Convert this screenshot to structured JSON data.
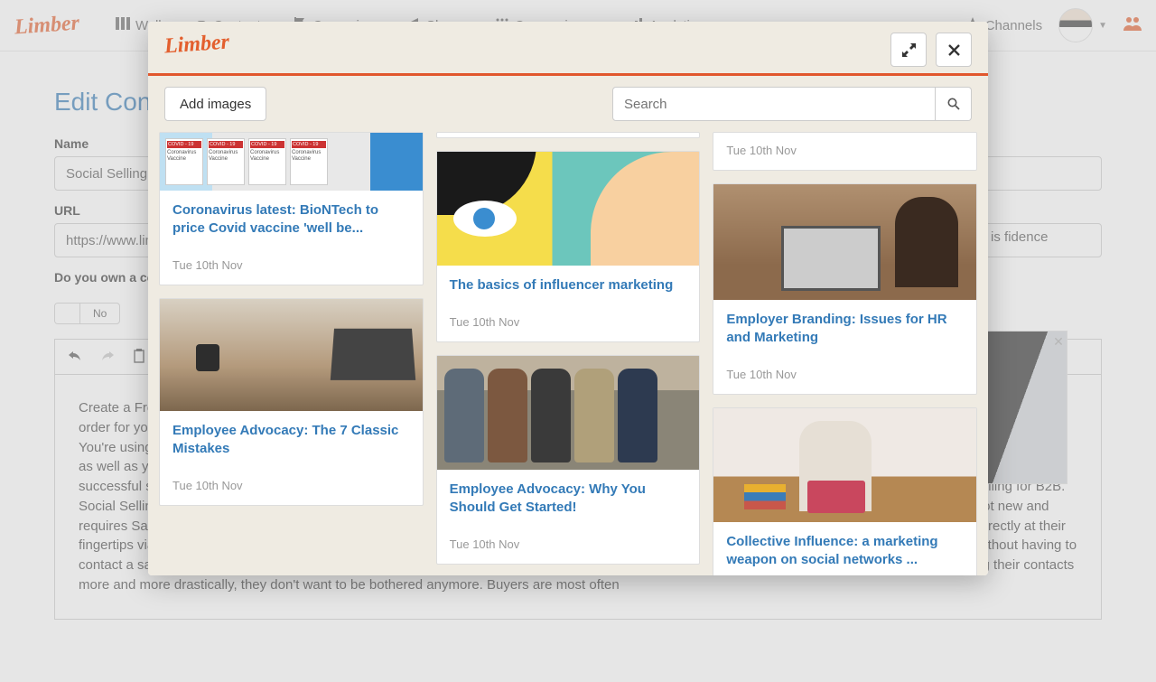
{
  "logo_text": "Limber",
  "nav": {
    "items": [
      {
        "label": "Walls",
        "dropdown": false
      },
      {
        "label": "Contents",
        "dropdown": false
      },
      {
        "label": "Campaigns",
        "dropdown": false
      },
      {
        "label": "Shares",
        "dropdown": false
      },
      {
        "label": "Conversions",
        "dropdown": true
      },
      {
        "label": "Analytics",
        "dropdown": true
      }
    ],
    "channels_label": "Channels"
  },
  "page": {
    "title": "Edit Content",
    "name_label": "Name",
    "name_value": "Social Selling: Be",
    "url_label": "URL",
    "url_value": "https://www.limbe",
    "own_label": "Do you own a copy",
    "toggle_value": "No",
    "right_snippet": "d social seller is fidence before",
    "body_text": "Create a Free Account to Discover all the features of LimberGet Started – Free Enterprise accounts allows you all the features of Limber. We offer a free account in order for you to discover Limber and how it fits your projects. Fill out the form and get started with your team. Max SwansonLeave a Comment You're doing it, right? You're using social media to grow your audience to inform them about your work and draw them into your sales funnel. Of course you are. However, it's not working, as well as you'd hoped or would like. Maybe you see others that seem to have it all figured out. Being on social media won't make you a good social seller. A successful social seller is someone who creates a personal brand, engages with their network, and builds relationships and confidence before Social Selling for B2B. Social Selling is a formidable lever for companies that want to add a new string to their bow and increase revenues. The social media phenomenon is not new and requires Salespeople to adapt. The changes are easy to understand and are not as recent as we think. Buyers have access to a wealth of information directly at their fingertips via the Internet and social networks. They can inform themselves, compare, and consider different options between alternative solutions, all without having to contact a sales representative. A Forrester study estimates that 70-80% of the buying journey is done online, alone. Prospective customers are selecting their contacts more and more drastically, they don't want to be bothered anymore. Buyers are most often"
  },
  "modal": {
    "add_images_label": "Add images",
    "search_placeholder": "Search",
    "cards": {
      "col1": [
        {
          "title": "Coronavirus latest: BioNTech to price Covid vaccine 'well be...",
          "date": "Tue 10th Nov"
        },
        {
          "title": "Employee Advocacy: The 7 Classic Mistakes",
          "date": "Tue 10th Nov"
        }
      ],
      "col2_top_date": "",
      "col2": [
        {
          "title": "The basics of influencer marketing",
          "date": "Tue 10th Nov"
        },
        {
          "title": "Employee Advocacy: Why You Should Get Started!",
          "date": "Tue 10th Nov"
        }
      ],
      "col3_top_date": "Tue 10th Nov",
      "col3": [
        {
          "title": "Employer Branding: Issues for HR and Marketing",
          "date": "Tue 10th Nov"
        },
        {
          "title": "Collective Influence: a marketing weapon on social networks ...",
          "date": ""
        }
      ]
    },
    "vial_label_header": "COVID - 19",
    "vial_label_line1": "Coronavirus",
    "vial_label_line2": "Vaccine"
  }
}
